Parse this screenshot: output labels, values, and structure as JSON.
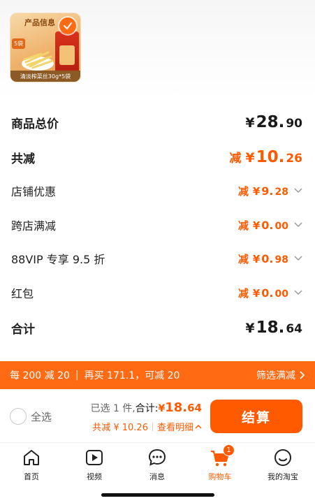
{
  "product": {
    "info_tag": "产品信息",
    "pack_badge": "5袋",
    "caption": "清淡榨菜丝30g*5袋"
  },
  "price_rows": [
    {
      "label": "商品总价",
      "prefix": "",
      "yen": "¥",
      "int": "28.",
      "dec": "90"
    },
    {
      "label": "共减",
      "prefix": "减",
      "yen": "¥",
      "int": "10.",
      "dec": "26"
    },
    {
      "label": "店铺优惠",
      "prefix": "减",
      "yen": "¥",
      "int": "9.",
      "dec": "28"
    },
    {
      "label": "跨店满减",
      "prefix": "减",
      "yen": "¥",
      "int": "0.",
      "dec": "00"
    },
    {
      "label": "88VIP 专享 9.5 折",
      "prefix": "减",
      "yen": "¥",
      "int": "0.",
      "dec": "98"
    },
    {
      "label": "红包",
      "prefix": "减",
      "yen": "¥",
      "int": "0.",
      "dec": "00"
    },
    {
      "label": "合计",
      "prefix": "",
      "yen": "¥",
      "int": "18.",
      "dec": "64"
    }
  ],
  "promo_bar": {
    "rule": "每 200 减 20",
    "buy_more": "再买 171.1，可减 20",
    "filter_label": "筛选满减"
  },
  "checkout": {
    "select_all": "全选",
    "selected_count": "已选 1 件,",
    "total_label": "合计:",
    "total_yen": "¥",
    "total_int": "18.",
    "total_dec": "64",
    "discount_text": "共减 ¥ 10.26",
    "detail_label": "查看明细",
    "checkout_label": "结算"
  },
  "tabs": [
    {
      "label": "首页",
      "icon": "home-icon"
    },
    {
      "label": "视频",
      "icon": "video-icon"
    },
    {
      "label": "消息",
      "icon": "message-icon"
    },
    {
      "label": "购物车",
      "icon": "cart-icon",
      "badge": "1",
      "active": true
    },
    {
      "label": "我的淘宝",
      "icon": "profile-icon"
    }
  ],
  "colors": {
    "accent": "#ff5a00",
    "promo_bar": "#ff6a13"
  }
}
